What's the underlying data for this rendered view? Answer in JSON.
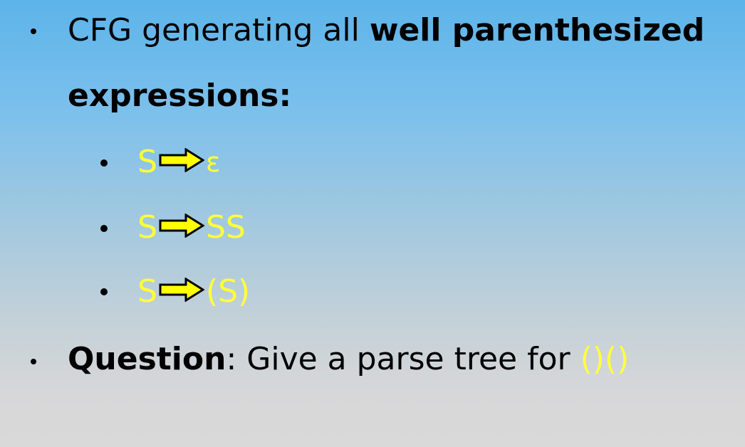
{
  "bullets": {
    "first": {
      "text_plain": "CFG generating all ",
      "text_bold": "well parenthesized",
      "text_bold_2": "expressions",
      "colon": ":"
    },
    "rules": [
      {
        "lhs": "S",
        "rhs": "ε"
      },
      {
        "lhs": "S",
        "rhs": "SS"
      },
      {
        "lhs": "S",
        "rhs": "(S)"
      }
    ],
    "question": {
      "label": "Question",
      "colon": ":",
      "text": " Give a parse tree for ",
      "expr": "()()"
    }
  },
  "icons": {
    "arrow": "right-arrow-icon"
  },
  "colors": {
    "highlight": "#ffff3a",
    "arrow_fill": "#ffff00",
    "text": "#000000"
  }
}
